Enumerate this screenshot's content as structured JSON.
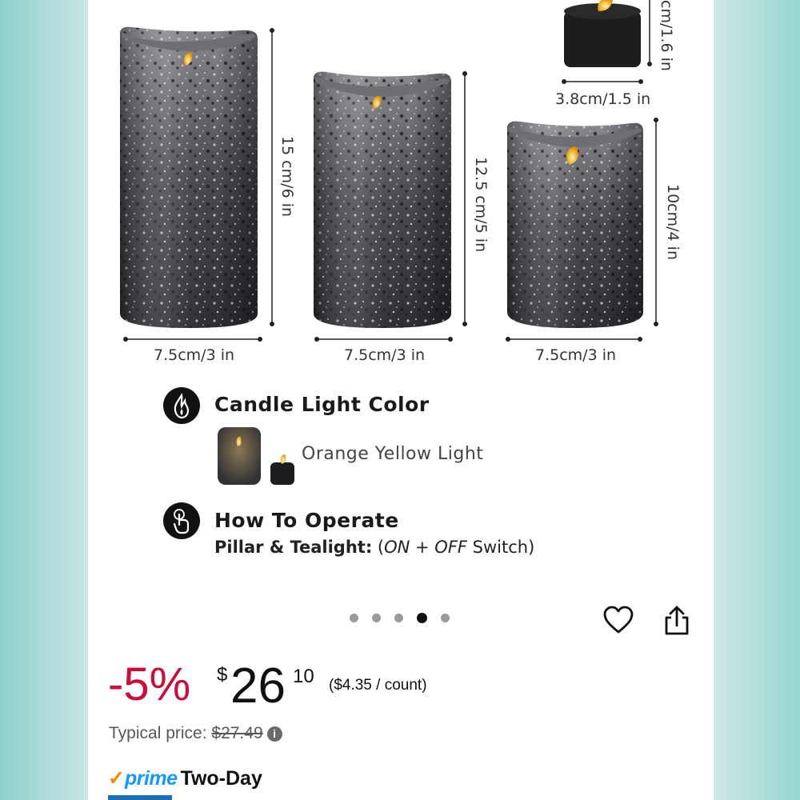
{
  "image_dims": {
    "tealight_height": "cm/1.6 in",
    "tealight_width": "3.8cm/1.5 in",
    "large_height": "15 cm/6 in",
    "medium_height": "12.5 cm/5 in",
    "small_height": "10cm/4 in",
    "large_width": "7.5cm/3 in",
    "medium_width": "7.5cm/3 in",
    "small_width": "7.5cm/3 in"
  },
  "features": {
    "light_title": "Candle Light Color",
    "light_value": "Orange Yellow Light",
    "operate_title": "How To Operate",
    "operate_label": "Pillar & Tealight:",
    "operate_open": "(",
    "operate_on": "ON + OFF",
    "operate_switch": " Switch)"
  },
  "carousel": {
    "total": 5,
    "active_index": 3
  },
  "price": {
    "discount": "-5%",
    "currency": "$",
    "whole": "26",
    "fraction": "10",
    "unit_price": "($4.35 / count)",
    "typical_label": "Typical price:",
    "typical_value": "$27.49",
    "info_glyph": "i"
  },
  "shipping": {
    "check": "✓",
    "prime": "prime",
    "speed": "Two-Day"
  },
  "colors": {
    "discount": "#cc0c39",
    "prime_blue": "#1399ff",
    "prime_check": "#f08804"
  }
}
